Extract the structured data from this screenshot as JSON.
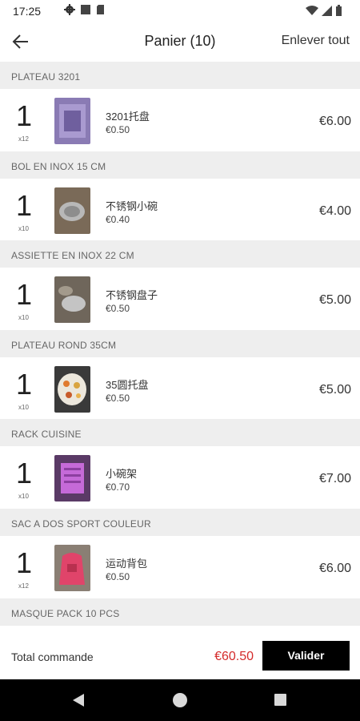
{
  "status_bar": {
    "time": "17:25",
    "left_icons": [
      "gear-icon",
      "square-icon",
      "sim-card-icon"
    ],
    "right_icons": [
      "wifi-icon",
      "signal-icon",
      "battery-icon"
    ]
  },
  "header": {
    "title": "Panier (10)",
    "clear_all_label": "Enlever tout",
    "back_icon": "arrow-left-icon"
  },
  "sections": [
    {
      "title": "PLATEAU 3201",
      "item": {
        "quantity": "1",
        "unit": "x12",
        "name": "3201托盘",
        "unit_price": "€0.50",
        "total": "€6.00",
        "thumb_color": "#8a7bb4"
      }
    },
    {
      "title": "BOL EN INOX  15 CM",
      "item": {
        "quantity": "1",
        "unit": "x10",
        "name": "不锈钢小碗",
        "unit_price": "€0.40",
        "total": "€4.00",
        "thumb_color": "#7a6a58"
      }
    },
    {
      "title": "ASSIETTE EN INOX 22 CM",
      "item": {
        "quantity": "1",
        "unit": "x10",
        "name": "不锈钢盘子",
        "unit_price": "€0.50",
        "total": "€5.00",
        "thumb_color": "#6f665b"
      }
    },
    {
      "title": "PLATEAU ROND 35CM",
      "item": {
        "quantity": "1",
        "unit": "x10",
        "name": "35圆托盘",
        "unit_price": "€0.50",
        "total": "€5.00",
        "thumb_color": "#c9a468"
      }
    },
    {
      "title": "RACK CUISINE",
      "item": {
        "quantity": "1",
        "unit": "x10",
        "name": "小碗架",
        "unit_price": "€0.70",
        "total": "€7.00",
        "thumb_color": "#b25fc7"
      }
    },
    {
      "title": "SAC A DOS SPORT COULEUR",
      "item": {
        "quantity": "1",
        "unit": "x12",
        "name": "运动背包",
        "unit_price": "€0.50",
        "total": "€6.00",
        "thumb_color": "#e0446a"
      }
    },
    {
      "title": "MASQUE PACK 10 PCS"
    }
  ],
  "footer": {
    "label": "Total commande",
    "total": "€60.50",
    "validate_label": "Valider"
  },
  "colors": {
    "accent_total": "#d42b2b",
    "button_bg": "#000000",
    "section_bg": "#eeeeee"
  }
}
